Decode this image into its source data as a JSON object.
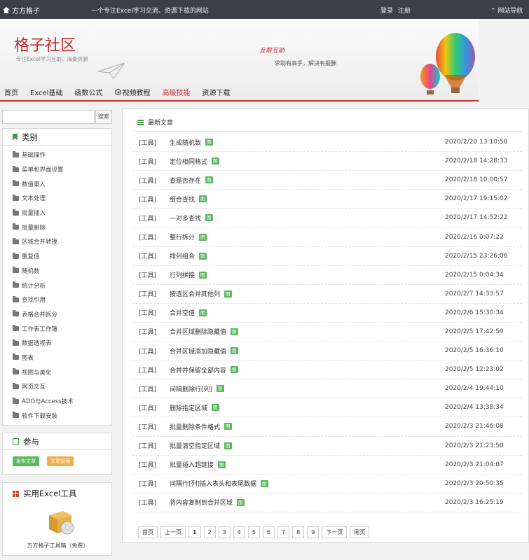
{
  "topbar": {
    "brand": "方方格子",
    "slogan": "一个专注Excel学习交流、资源下载的网站",
    "login": "登录",
    "register": "注册",
    "site_nav": "网站导航"
  },
  "header": {
    "logo_title": "格子社区",
    "logo_sub": "专注Excel学习互助，海量资源",
    "tagline1": "互帮互助",
    "tagline2": "求助有高手，解决有报酬"
  },
  "nav": [
    {
      "label": "首页"
    },
    {
      "label": "Excel基础"
    },
    {
      "label": "函数公式"
    },
    {
      "label": "视频教程"
    },
    {
      "label": "高级技能"
    },
    {
      "label": "资源下载"
    }
  ],
  "search": {
    "button": "搜索",
    "placeholder": ""
  },
  "categories": {
    "title": "类别",
    "items": [
      "基础操作",
      "菜单和界面设置",
      "数值录入",
      "文本处理",
      "批量插入",
      "批量删除",
      "区域合并转换",
      "重复值",
      "随机数",
      "统计分析",
      "查找引用",
      "表格合并拆分",
      "工作表工作簿",
      "数据透视表",
      "图表",
      "视图与美化",
      "网页交互",
      "ADO与Access技术",
      "软件下载安装"
    ]
  },
  "join": {
    "title": "参与",
    "btn_post": "发布文章",
    "btn_manage": "文章管理"
  },
  "tools": {
    "title": "实用Excel工具",
    "toolbox_label": "方方格子工具箱（免费）"
  },
  "articles": {
    "heading": "最新文章",
    "badge": "图",
    "rows": [
      {
        "tag": "[工具]",
        "title": "生成随机数",
        "date": "2020/2/20 13:10:58"
      },
      {
        "tag": "[工具]",
        "title": "定位相同格式",
        "date": "2020/2/18 14:28:33"
      },
      {
        "tag": "[工具]",
        "title": "查是否存在",
        "date": "2020/2/18 10:00:57"
      },
      {
        "tag": "[工具]",
        "title": "组合查找",
        "date": "2020/2/17 19:15:02"
      },
      {
        "tag": "[工具]",
        "title": "一对多查找",
        "date": "2020/2/17 14:52:22"
      },
      {
        "tag": "[工具]",
        "title": "整行拆分",
        "date": "2020/2/16 0:07:22"
      },
      {
        "tag": "[工具]",
        "title": "排列组合",
        "date": "2020/2/15 23:26:06"
      },
      {
        "tag": "[工具]",
        "title": "行列拼接",
        "date": "2020/2/15 0:04:34"
      },
      {
        "tag": "[工具]",
        "title": "按选区合并其他列",
        "date": "2020/2/7 14:33:57"
      },
      {
        "tag": "[工具]",
        "title": "合并空值",
        "date": "2020/2/6 15:30:34"
      },
      {
        "tag": "[工具]",
        "title": "合并区域删除隐藏值",
        "date": "2020/2/5 17:42:50"
      },
      {
        "tag": "[工具]",
        "title": "合并区域添加隐藏值",
        "date": "2020/2/5 16:36:10"
      },
      {
        "tag": "[工具]",
        "title": "合并并保留全部内容",
        "date": "2020/2/5 12:23:02"
      },
      {
        "tag": "[工具]",
        "title": "间隔删除行[列]",
        "date": "2020/2/4 19:44:10"
      },
      {
        "tag": "[工具]",
        "title": "删除指定区域",
        "date": "2020/2/4 13:38:34"
      },
      {
        "tag": "[工具]",
        "title": "批量删除条件格式",
        "date": "2020/2/3 21:46:08"
      },
      {
        "tag": "[工具]",
        "title": "批量清空指定区域",
        "date": "2020/2/3 21:23:50"
      },
      {
        "tag": "[工具]",
        "title": "批量插入超链接",
        "date": "2020/2/3 21:04:07"
      },
      {
        "tag": "[工具]",
        "title": "间隔行[列]插入表头和表尾数据",
        "date": "2020/2/3 20:50:35"
      },
      {
        "tag": "[工具]",
        "title": "将内容复制到合并区域",
        "date": "2020/2/3 16:25:19"
      }
    ]
  },
  "pager": {
    "first": "首页",
    "prev": "上一页",
    "pages": [
      "1",
      "2",
      "3",
      "4",
      "5",
      "6",
      "7",
      "8",
      "9"
    ],
    "next": "下一页",
    "last": "尾页",
    "current": "1"
  },
  "colors": {
    "accent": "#c62b2b",
    "topbar": "#3b4048",
    "green": "#5cb85c",
    "orange": "#f0ad4e"
  }
}
